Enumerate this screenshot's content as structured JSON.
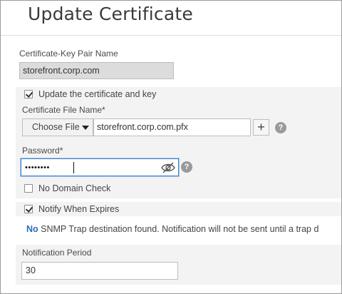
{
  "page": {
    "title": "Update Certificate"
  },
  "cert_key_pair": {
    "label": "Certificate-Key Pair Name",
    "value": "storefront.corp.com"
  },
  "update_section": {
    "update_checkbox_label": "Update the certificate and key",
    "update_checked": true,
    "cert_file_label": "Certificate File Name*",
    "choose_file_label": "Choose File",
    "cert_file_value": "storefront.corp.com.pfx",
    "add_button_label": "+",
    "help_glyph": "?",
    "password_label": "Password*",
    "password_mask": "••••••••",
    "no_domain_check_label": "No Domain Check",
    "no_domain_check_checked": false
  },
  "notify": {
    "label": "Notify When Expires",
    "checked": true,
    "notice_strong": "No",
    "notice_rest": " SNMP Trap destination found. Notification will not be sent until a trap d"
  },
  "notification_period": {
    "label": "Notification Period",
    "value": "30"
  },
  "icons": {
    "password_toggle": "eye-slash-icon",
    "help": "help-circle-icon",
    "dropdown": "caret-down-icon"
  },
  "colors": {
    "accent_blue": "#2a6db5",
    "focus_border": "#3a82c8",
    "section_bg": "#f3f3f3"
  }
}
